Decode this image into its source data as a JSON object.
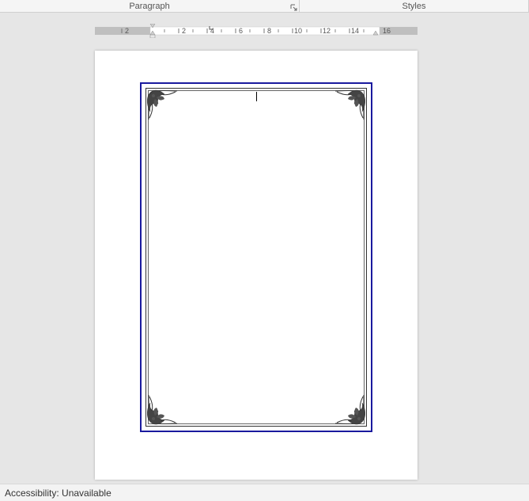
{
  "ribbon": {
    "groups": {
      "paragraph": {
        "label": "Paragraph"
      },
      "styles": {
        "label": "Styles"
      }
    }
  },
  "ruler": {
    "left_gray_end": 0,
    "right_gray_start": 15.8,
    "major_ticks": [
      2,
      4,
      6,
      8,
      10,
      12,
      14,
      16
    ],
    "negative_ticks": [
      2
    ],
    "first_line_indent": 1.4,
    "hanging_indent": 1.4,
    "right_indent": 15.4
  },
  "document": {
    "border_selected": true,
    "border_color": "#1a1a9e",
    "page_background": "#ffffff"
  },
  "status": {
    "accessibility_label": "Accessibility:",
    "accessibility_value": "Unavailable"
  }
}
